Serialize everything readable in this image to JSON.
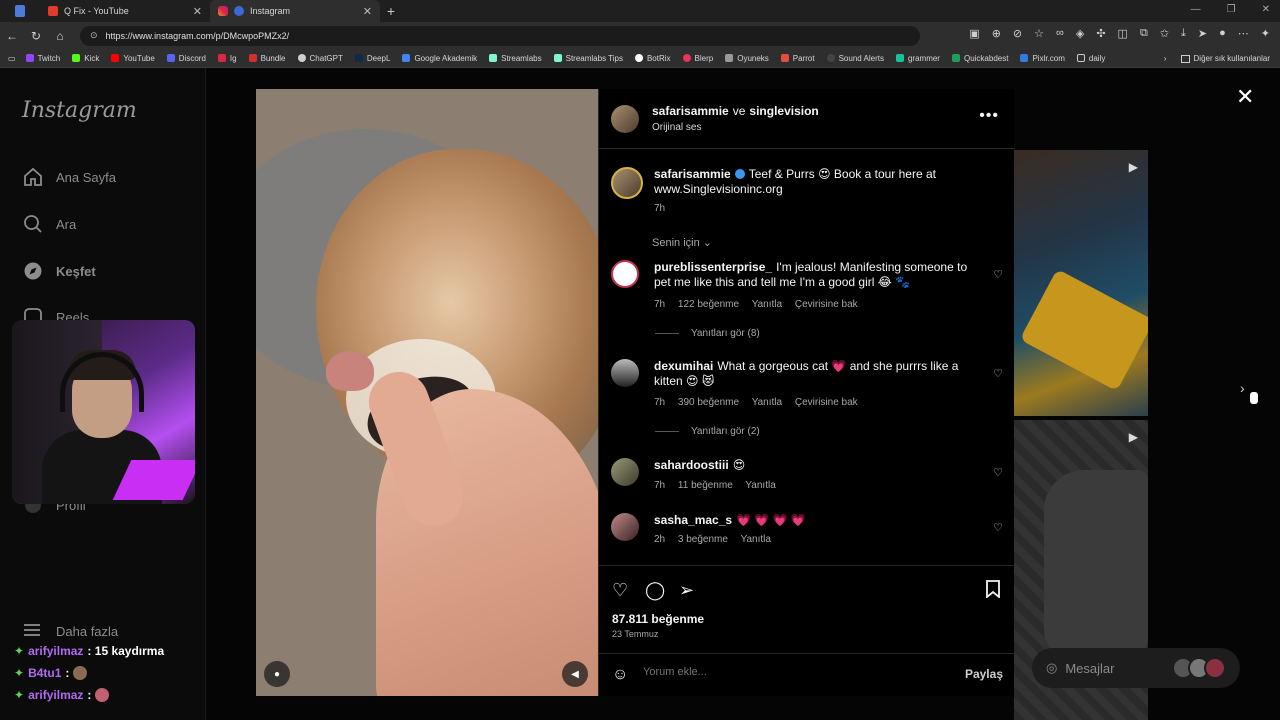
{
  "browser": {
    "tabs": [
      {
        "title": "Q Fix - YouTube"
      },
      {
        "title": "Instagram"
      }
    ],
    "url": "https://www.instagram.com/p/DMcwpoPMZx2/",
    "bookmarks": [
      "Twitch",
      "Kick",
      "YouTube",
      "Discord",
      "Ig",
      "Bundle",
      "ChatGPT",
      "DeepL",
      "Google Akademik",
      "Streamlabs",
      "Streamlabs Tips",
      "BotRix",
      "Blerp",
      "Oyuneks",
      "Parrot",
      "Sound Alerts",
      "grammer",
      "Quickabdest",
      "Pixlr.com",
      "daily"
    ],
    "bookmarks_other": "Diğer sık kullanılanlar"
  },
  "sidebar": {
    "logo": "Instagram",
    "items": [
      {
        "label": "Ana Sayfa",
        "icon": "home-icon"
      },
      {
        "label": "Ara",
        "icon": "search-icon"
      },
      {
        "label": "Keşfet",
        "icon": "compass-icon"
      },
      {
        "label": "Reels",
        "icon": "reels-icon"
      },
      {
        "label": "Profil",
        "icon": "profile-icon"
      },
      {
        "label": "Daha fazla",
        "icon": "menu-icon"
      }
    ]
  },
  "stream_chat": [
    {
      "user": "arifyilmaz",
      "msg": "15 kaydırma"
    },
    {
      "user": "B4tu1",
      "msg": ""
    },
    {
      "user": "arifyilmaz",
      "msg": ""
    }
  ],
  "post": {
    "header": {
      "user1": "safarisammie",
      "conj": "ve",
      "user2": "singlevision",
      "audio": "Orijinal ses"
    },
    "caption": {
      "user": "safarisammie",
      "text": "Teef & Purrs 😍 Book a tour here at www.Singlevisioninc.org",
      "time": "7h"
    },
    "filter": "Senin için",
    "comments": [
      {
        "user": "pureblissenterprise_",
        "text": "I'm jealous! Manifesting someone to pet me like this and tell me I'm a good girl 😂 🐾",
        "time": "7h",
        "likes": "122 beğenme",
        "reply": "Yanıtla",
        "translate": "Çevirisine bak",
        "replies": "Yanıtları gör (8)"
      },
      {
        "user": "dexumihai",
        "text": "What a gorgeous cat 💗 and she purrrs like a kitten 😍 😻",
        "time": "7h",
        "likes": "390 beğenme",
        "reply": "Yanıtla",
        "translate": "Çevirisine bak",
        "replies": "Yanıtları gör (2)"
      },
      {
        "user": "sahardoostiii",
        "text": "😍",
        "time": "7h",
        "likes": "11 beğenme",
        "reply": "Yanıtla"
      },
      {
        "user": "sasha_mac_s",
        "text": "💗 💗 💗 💗",
        "time": "2h",
        "likes": "3 beğenme",
        "reply": "Yanıtla"
      }
    ],
    "likes": "87.811 beğenme",
    "date": "23 Temmuz",
    "comment_placeholder": "Yorum ekle...",
    "share": "Paylaş"
  },
  "messages": {
    "label": "Mesajlar"
  }
}
